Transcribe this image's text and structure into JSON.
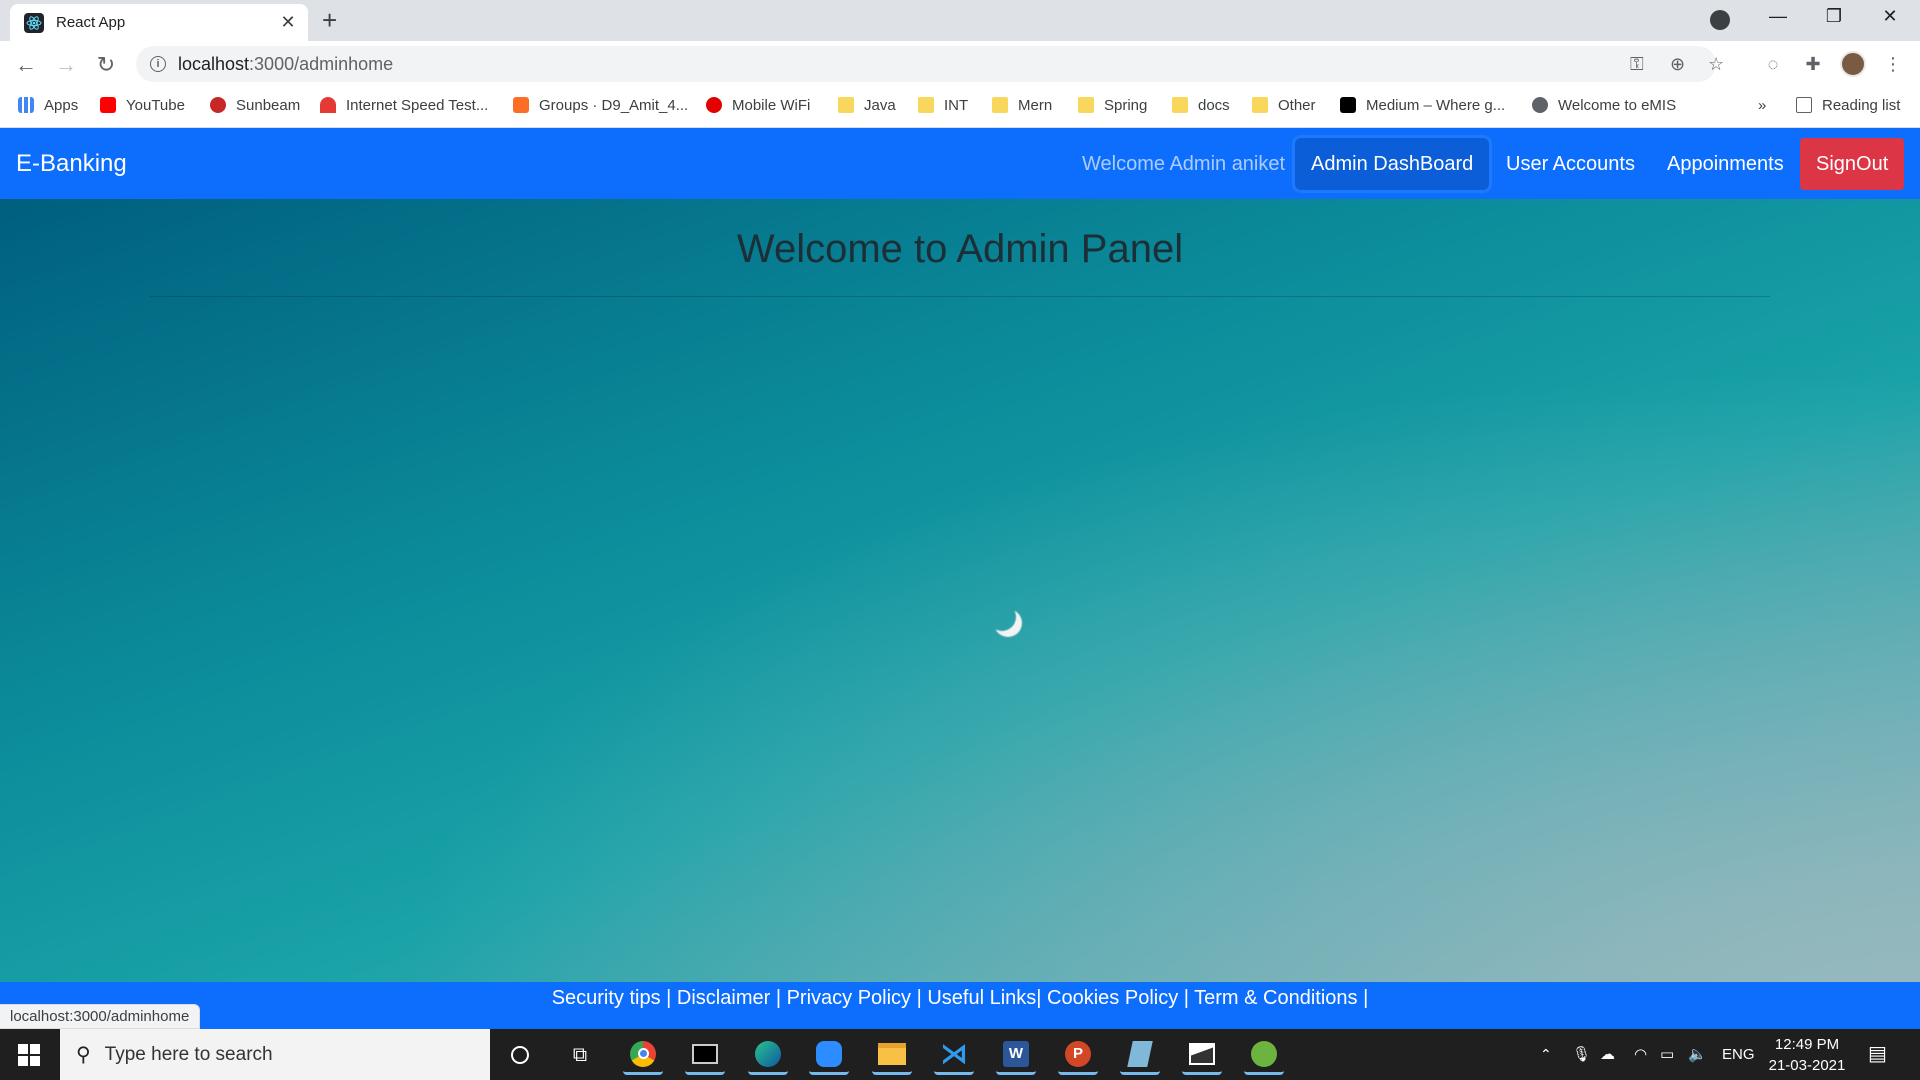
{
  "browser": {
    "tab_title": "React App",
    "url_host": "localhost",
    "url_rest": ":3000/adminhome",
    "bookmarks": [
      "Apps",
      "YouTube",
      "Sunbeam",
      "Internet Speed Test...",
      "Groups · D9_Amit_4...",
      "Mobile WiFi",
      "Java",
      "INT",
      "Mern",
      "Spring",
      "docs",
      "Other",
      "Medium – Where g...",
      "Welcome to eMIS"
    ],
    "reading_list": "Reading list",
    "more_bookmarks": "»",
    "status_url": "localhost:3000/adminhome"
  },
  "navbar": {
    "brand": "E-Banking",
    "welcome": "Welcome Admin aniket",
    "items": [
      "Admin DashBoard",
      "User Accounts",
      "Appoinments"
    ],
    "signout": "SignOut"
  },
  "main": {
    "title": "Welcome to Admin Panel"
  },
  "footer": {
    "links": "Security tips | Disclaimer | Privacy Policy | Useful Links| Cookies Policy | Term & Conditions |"
  },
  "taskbar": {
    "search_placeholder": "Type here to search",
    "language": "ENG",
    "time": "12:49 PM",
    "date": "21-03-2021"
  },
  "colors": {
    "navbar": "#0d6efd",
    "signout": "#dc3545",
    "hero_start": "#005f7e",
    "hero_end": "#8fb6ba"
  }
}
